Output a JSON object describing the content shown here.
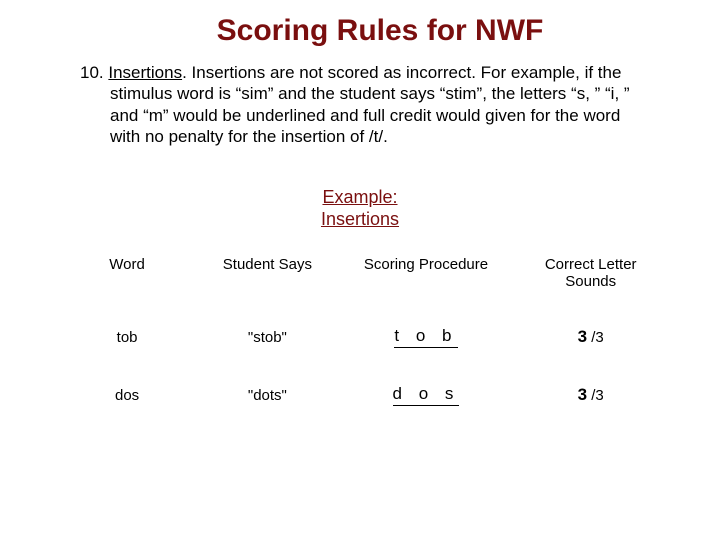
{
  "title": "Scoring Rules for NWF",
  "rule": {
    "number": "10.",
    "term": "Insertions",
    "text_after_term": ". Insertions are not scored as incorrect. For example, if the stimulus word is “sim” and the student says “stim”, the letters “s, ” “i, ” and “m” would be underlined and full credit would given for the word with no penalty for the insertion of /t/."
  },
  "example_label_line1": "Example:",
  "example_label_line2": "Insertions",
  "headers": {
    "word": "Word",
    "says": "Student Says",
    "procedure": "Scoring Procedure",
    "correct": "Correct Letter Sounds"
  },
  "rows": [
    {
      "word": "tob",
      "says": "\"stob\"",
      "procedure": "t o b",
      "score_big": "3",
      "score_rest": " /3"
    },
    {
      "word": "dos",
      "says": "\"dots\"",
      "procedure": "d o s",
      "score_big": "3",
      "score_rest": " /3"
    }
  ],
  "chart_data": {
    "type": "table",
    "title": "Example: Insertions",
    "columns": [
      "Word",
      "Student Says",
      "Scoring Procedure",
      "Correct Letter Sounds"
    ],
    "rows": [
      [
        "tob",
        "\"stob\"",
        "t o b",
        "3 /3"
      ],
      [
        "dos",
        "\"dots\"",
        "d o s",
        "3 /3"
      ]
    ]
  }
}
